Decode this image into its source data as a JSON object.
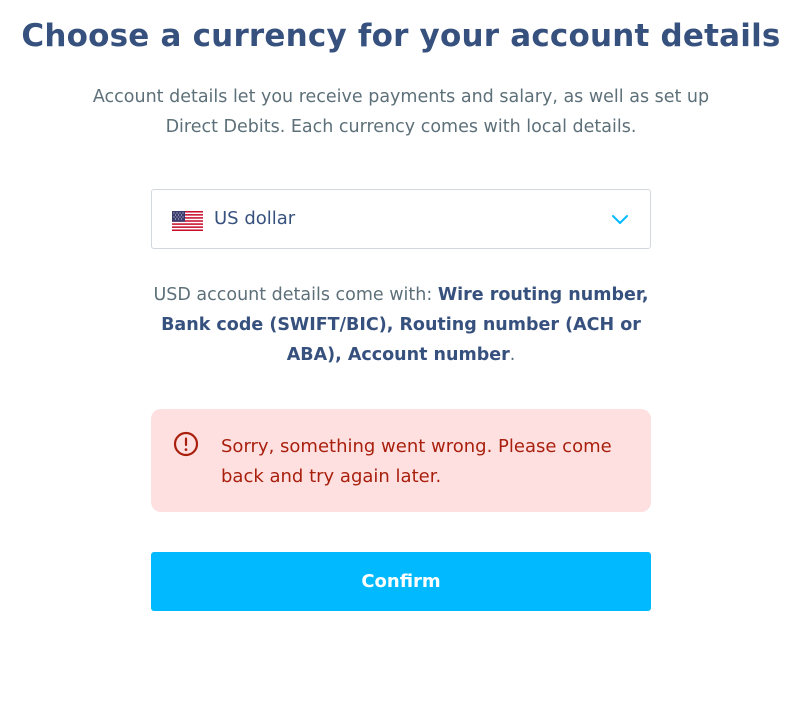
{
  "page": {
    "title": "Choose a currency for your account details",
    "intro": "Account details let you receive payments and salary, as well as set up Direct Debits. Each currency comes with local details."
  },
  "currency_select": {
    "selected_label": "US dollar",
    "flag_icon": "us-flag-icon",
    "dropdown_icon": "chevron-down-icon"
  },
  "details": {
    "prefix": "USD account details come with: ",
    "items": "Wire routing number, Bank code (SWIFT/BIC), Routing number (ACH or ABA), Account number",
    "suffix": "."
  },
  "alert": {
    "icon": "error-circle-icon",
    "message": "Sorry, something went wrong. Please come back and try again later."
  },
  "actions": {
    "confirm_label": "Confirm"
  },
  "colors": {
    "heading": "#37517e",
    "body_text": "#5d7079",
    "accent": "#00b9ff",
    "error_text": "#a8200d",
    "error_bg": "#ffe0e0"
  }
}
